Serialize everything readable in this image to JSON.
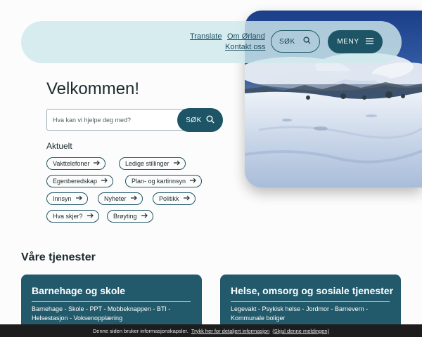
{
  "header": {
    "links": {
      "translate": "Translate",
      "om": "Om Ørland",
      "kontakt": "Kontakt oss"
    },
    "search_label": "SØK",
    "menu_label": "MENY",
    "search_icon": "search-icon",
    "menu_icon": "hamburger-icon"
  },
  "welcome": {
    "title": "Velkommen!",
    "search_placeholder": "Hva kan vi hjelpe deg med?",
    "search_value": "",
    "search_button": "SØK"
  },
  "aktuelt": {
    "heading": "Aktuelt",
    "chips": [
      "Vakttelefoner",
      "Ledige stillinger",
      "Egenberedskap",
      "Plan- og kartinnsyn",
      "Innsyn",
      "Nyheter",
      "Politikk",
      "Hva skjer?",
      "Brøyting"
    ]
  },
  "services": {
    "heading": "Våre tjenester",
    "cards": [
      {
        "title": "Barnehage og skole",
        "text": "Barnehage - Skole - PPT - Mobbeknappen - BTI - Helsestasjon - Voksenopplæring"
      },
      {
        "title": "Helse, omsorg og sosiale tjenester",
        "text": "Legevakt - Psykisk helse - Jordmor - Barnevern - Kommunale boliger"
      }
    ]
  },
  "cookie": {
    "text": "Denne siden bruker informasjonskapsler.",
    "info_link": "Trykk her for detaljert informasjon",
    "dismiss_link": "(Skjul denne meldingen)"
  },
  "colors": {
    "brand": "#1d5566",
    "header_bg": "#cee8ea",
    "page_bg": "#fbfcfb"
  }
}
